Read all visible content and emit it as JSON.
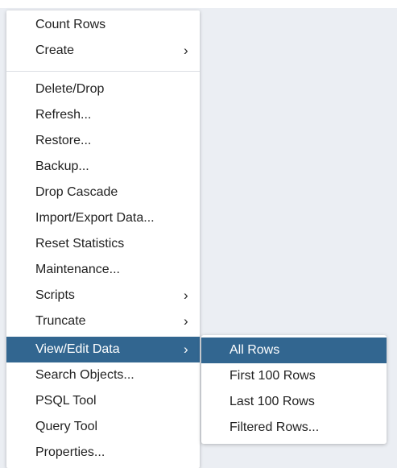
{
  "context_menu": {
    "items": [
      {
        "label": "Count Rows",
        "submenu": false
      },
      {
        "label": "Create",
        "submenu": true,
        "chevron": "chevron-right-icon"
      },
      {
        "label": "Delete/Drop",
        "submenu": false
      },
      {
        "label": "Refresh...",
        "submenu": false
      },
      {
        "label": "Restore...",
        "submenu": false
      },
      {
        "label": "Backup...",
        "submenu": false
      },
      {
        "label": "Drop Cascade",
        "submenu": false
      },
      {
        "label": "Import/Export Data...",
        "submenu": false
      },
      {
        "label": "Reset Statistics",
        "submenu": false
      },
      {
        "label": "Maintenance...",
        "submenu": false
      },
      {
        "label": "Scripts",
        "submenu": true,
        "chevron": "chevron-right-icon"
      },
      {
        "label": "Truncate",
        "submenu": true,
        "chevron": "chevron-right-icon"
      },
      {
        "label": "View/Edit Data",
        "submenu": true,
        "chevron": "chevron-right-icon",
        "active": true
      },
      {
        "label": "Search Objects...",
        "submenu": false
      },
      {
        "label": "PSQL Tool",
        "submenu": false
      },
      {
        "label": "Query Tool",
        "submenu": false
      },
      {
        "label": "Properties...",
        "submenu": false
      }
    ],
    "chevron_glyph": "›"
  },
  "view_edit_submenu": {
    "items": [
      {
        "label": "All Rows",
        "active": true
      },
      {
        "label": "First 100 Rows"
      },
      {
        "label": "Last 100 Rows"
      },
      {
        "label": "Filtered Rows..."
      }
    ]
  },
  "colors": {
    "highlight": "#326690",
    "background": "#ebeef3",
    "menu_background": "#ffffff",
    "text": "#222222"
  }
}
